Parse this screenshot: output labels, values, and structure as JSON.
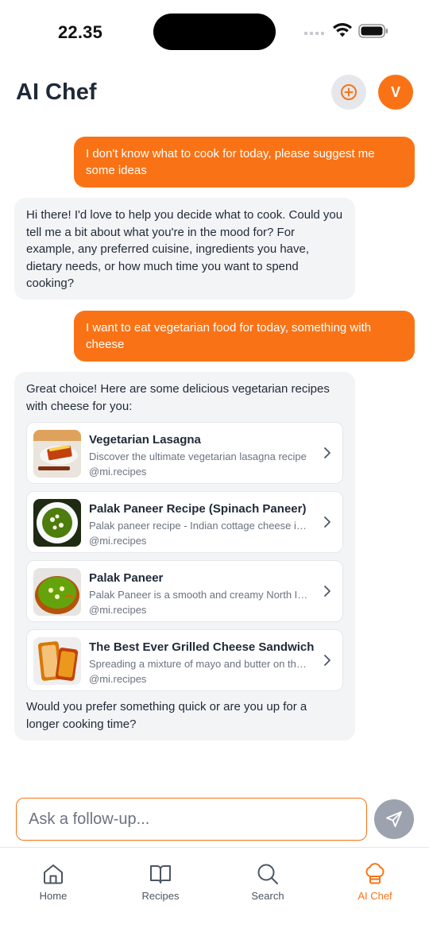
{
  "status_bar": {
    "time": "22.35"
  },
  "header": {
    "title": "AI Chef",
    "new_chat_icon": "plus-circle-icon",
    "avatar_initial": "V"
  },
  "messages": [
    {
      "role": "user",
      "text": "I don't know what to cook for today, please suggest me some ideas"
    },
    {
      "role": "assistant",
      "text": "Hi there! I'd love to help you decide what to cook. Could you tell me a bit about what you're in the mood for? For example, any preferred cuisine, ingredients you have, dietary needs, or how much time you want to spend cooking?"
    },
    {
      "role": "user",
      "text": "I want to eat vegetarian food for today, something with cheese"
    },
    {
      "role": "assistant",
      "intro": "Great choice! Here are some delicious vegetarian recipes with cheese for you:",
      "recipes": [
        {
          "title": "Vegetarian Lasagna",
          "description": "Discover the ultimate vegetarian lasagna recipe",
          "source": "@mi.recipes"
        },
        {
          "title": "Palak Paneer Recipe (Spinach Paneer)",
          "description": "Palak paneer recipe - Indian cottage cheese in spinach gravy",
          "source": "@mi.recipes"
        },
        {
          "title": "Palak Paneer",
          "description": "Palak Paneer is a smooth and creamy North Indian curry",
          "source": "@mi.recipes"
        },
        {
          "title": "The Best Ever Grilled Cheese Sandwich",
          "description": "Spreading a mixture of mayo and butter on the bread",
          "source": "@mi.recipes"
        }
      ],
      "outro": "Would you prefer something quick or are you up for a longer cooking time?"
    }
  ],
  "input": {
    "placeholder": "Ask a follow-up..."
  },
  "tabs": [
    {
      "label": "Home",
      "icon": "home-icon",
      "active": false
    },
    {
      "label": "Recipes",
      "icon": "book-icon",
      "active": false
    },
    {
      "label": "Search",
      "icon": "search-icon",
      "active": false
    },
    {
      "label": "AI Chef",
      "icon": "chef-hat-icon",
      "active": true
    }
  ],
  "colors": {
    "accent": "#f97316",
    "bubble_ai": "#f3f4f6",
    "send_disabled": "#9ca3af"
  }
}
